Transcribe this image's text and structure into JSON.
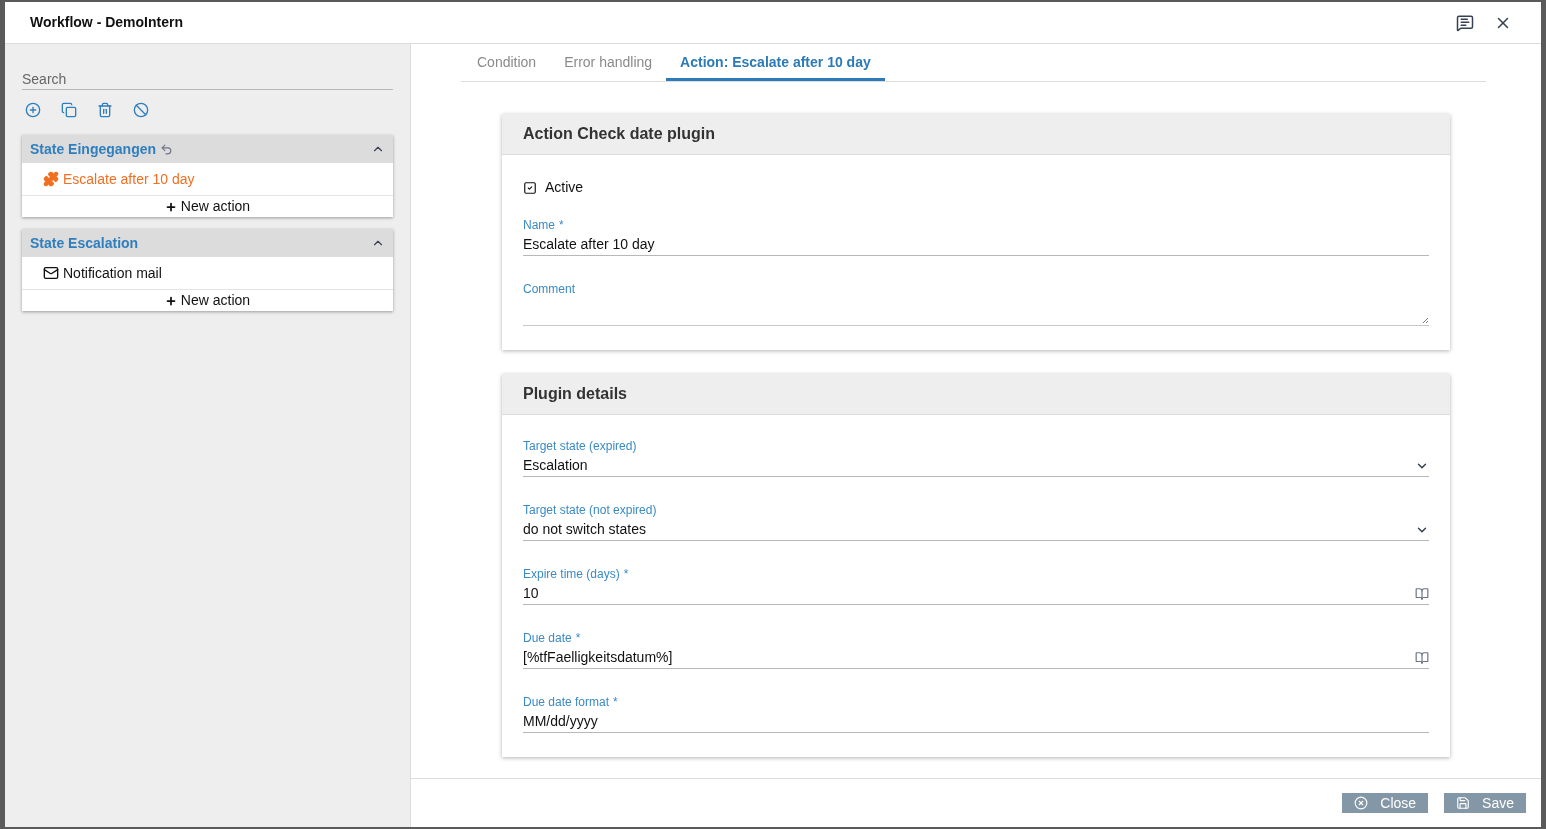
{
  "window": {
    "title": "Workflow - DemoIntern"
  },
  "sidebar": {
    "search": {
      "placeholder": "Search"
    },
    "states": [
      {
        "title": "State Eingegangen",
        "return_icon": true,
        "expanded": true,
        "actions": [
          {
            "label": "Escalate after 10 day",
            "kind": "plugin",
            "selected": true
          }
        ],
        "new_action": "New action"
      },
      {
        "title": "State Escalation",
        "return_icon": false,
        "expanded": true,
        "actions": [
          {
            "label": "Notification mail",
            "kind": "mail",
            "selected": false
          }
        ],
        "new_action": "New action"
      }
    ]
  },
  "tabs": [
    {
      "label": "Condition",
      "selected": false
    },
    {
      "label": "Error handling",
      "selected": false
    },
    {
      "label": "Action: Escalate after 10 day",
      "selected": true
    }
  ],
  "cards": [
    {
      "title": "Action Check date plugin",
      "checkbox": {
        "label": "Active",
        "checked": true
      },
      "fields": [
        {
          "kind": "text",
          "label": "Name",
          "required_mark": "*",
          "value": "Escalate after 10 day"
        },
        {
          "kind": "textarea",
          "label": "Comment"
        }
      ]
    },
    {
      "title": "Plugin details",
      "fields": [
        {
          "kind": "select",
          "label": "Target state (expired)",
          "value": "Escalation"
        },
        {
          "kind": "select",
          "label": "Target state (not expired)",
          "value": "do not switch states"
        },
        {
          "kind": "lookup",
          "label": "Expire time (days)",
          "required_mark": "*",
          "value": "10"
        },
        {
          "kind": "lookup",
          "label": "Due date",
          "required_mark": "*",
          "value": "[%tfFaelligkeitsdatum%]"
        },
        {
          "kind": "text",
          "label": "Due date format",
          "required_mark": "*",
          "value": "MM/dd/yyyy"
        }
      ]
    }
  ],
  "footer": {
    "buttons": [
      {
        "label": "Close",
        "kind": "close"
      },
      {
        "label": "Save",
        "kind": "save"
      }
    ]
  }
}
